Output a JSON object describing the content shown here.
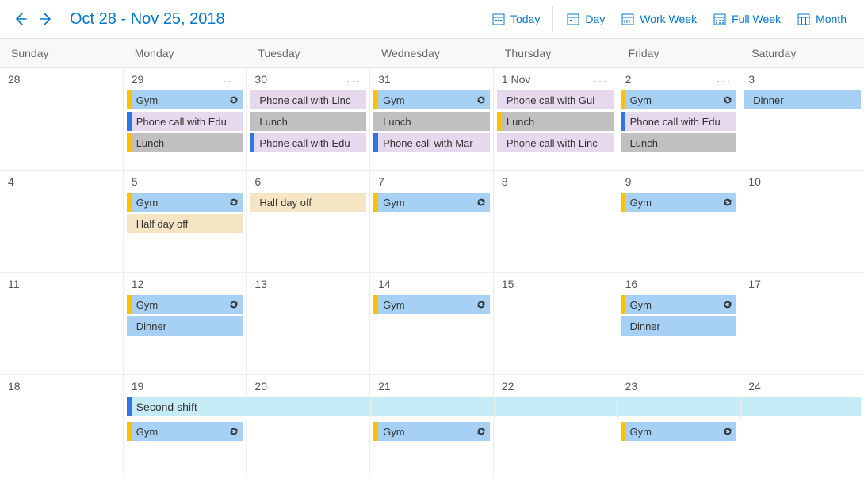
{
  "header": {
    "title": "Oct 28 - Nov 25, 2018",
    "today": "Today",
    "day": "Day",
    "workweek": "Work Week",
    "fullweek": "Full Week",
    "month": "Month"
  },
  "days": [
    "Sunday",
    "Monday",
    "Tuesday",
    "Wednesday",
    "Thursday",
    "Friday",
    "Saturday"
  ],
  "weeks": [
    {
      "cells": [
        {
          "date": "28",
          "overflow": false,
          "events": []
        },
        {
          "date": "29",
          "overflow": true,
          "events": [
            {
              "label": "Gym",
              "bg": "bg-blue",
              "bar": "bar-yellow",
              "recur": true
            },
            {
              "label": "Phone call with Edu",
              "bg": "bg-purple",
              "bar": "bar-blue",
              "recur": false
            },
            {
              "label": "Lunch",
              "bg": "bg-gray",
              "bar": "bar-yellow",
              "recur": false
            }
          ]
        },
        {
          "date": "30",
          "overflow": true,
          "events": [
            {
              "label": "Phone call with Linc",
              "bg": "bg-purple",
              "bar": "bar-none",
              "recur": false
            },
            {
              "label": "Lunch",
              "bg": "bg-gray",
              "bar": "bar-none",
              "recur": false
            },
            {
              "label": "Phone call with Edu",
              "bg": "bg-purple",
              "bar": "bar-blue",
              "recur": false
            }
          ]
        },
        {
          "date": "31",
          "overflow": false,
          "events": [
            {
              "label": "Gym",
              "bg": "bg-blue",
              "bar": "bar-yellow",
              "recur": true
            },
            {
              "label": "Lunch",
              "bg": "bg-gray",
              "bar": "bar-none",
              "recur": false
            },
            {
              "label": "Phone call with Mar",
              "bg": "bg-purple",
              "bar": "bar-blue",
              "recur": false
            }
          ]
        },
        {
          "date": "1 Nov",
          "overflow": true,
          "events": [
            {
              "label": "Phone call with Gui",
              "bg": "bg-purple",
              "bar": "bar-none",
              "recur": false
            },
            {
              "label": "Lunch",
              "bg": "bg-gray",
              "bar": "bar-yellow",
              "recur": false
            },
            {
              "label": "Phone call with Linc",
              "bg": "bg-purple",
              "bar": "bar-none",
              "recur": false
            }
          ]
        },
        {
          "date": "2",
          "overflow": true,
          "events": [
            {
              "label": "Gym",
              "bg": "bg-blue",
              "bar": "bar-yellow",
              "recur": true
            },
            {
              "label": "Phone call with Edu",
              "bg": "bg-purple",
              "bar": "bar-blue",
              "recur": false
            },
            {
              "label": "Lunch",
              "bg": "bg-gray",
              "bar": "bar-none",
              "recur": false
            }
          ]
        },
        {
          "date": "3",
          "overflow": false,
          "events": [
            {
              "label": "Dinner",
              "bg": "bg-blue",
              "bar": "bar-none",
              "recur": false
            }
          ]
        }
      ]
    },
    {
      "cells": [
        {
          "date": "4",
          "overflow": false,
          "events": []
        },
        {
          "date": "5",
          "overflow": false,
          "events": [
            {
              "label": "Gym",
              "bg": "bg-blue",
              "bar": "bar-yellow",
              "recur": true
            },
            {
              "label": "Half day off",
              "bg": "bg-beige",
              "bar": "bar-none",
              "recur": false
            }
          ]
        },
        {
          "date": "6",
          "overflow": false,
          "events": [
            {
              "label": "Half day off",
              "bg": "bg-beige",
              "bar": "bar-none",
              "recur": false
            }
          ]
        },
        {
          "date": "7",
          "overflow": false,
          "events": [
            {
              "label": "Gym",
              "bg": "bg-blue",
              "bar": "bar-yellow",
              "recur": true
            }
          ]
        },
        {
          "date": "8",
          "overflow": false,
          "events": []
        },
        {
          "date": "9",
          "overflow": false,
          "events": [
            {
              "label": "Gym",
              "bg": "bg-blue",
              "bar": "bar-yellow",
              "recur": true
            }
          ]
        },
        {
          "date": "10",
          "overflow": false,
          "events": []
        }
      ]
    },
    {
      "cells": [
        {
          "date": "11",
          "overflow": false,
          "events": []
        },
        {
          "date": "12",
          "overflow": false,
          "events": [
            {
              "label": "Gym",
              "bg": "bg-blue",
              "bar": "bar-yellow",
              "recur": true
            },
            {
              "label": "Dinner",
              "bg": "bg-blue",
              "bar": "bar-none",
              "recur": false
            }
          ]
        },
        {
          "date": "13",
          "overflow": false,
          "events": []
        },
        {
          "date": "14",
          "overflow": false,
          "events": [
            {
              "label": "Gym",
              "bg": "bg-blue",
              "bar": "bar-yellow",
              "recur": true
            }
          ]
        },
        {
          "date": "15",
          "overflow": false,
          "events": []
        },
        {
          "date": "16",
          "overflow": false,
          "events": [
            {
              "label": "Gym",
              "bg": "bg-blue",
              "bar": "bar-yellow",
              "recur": true
            },
            {
              "label": "Dinner",
              "bg": "bg-blue",
              "bar": "bar-none",
              "recur": false
            }
          ]
        },
        {
          "date": "17",
          "overflow": false,
          "events": []
        }
      ]
    },
    {
      "cells": [
        {
          "date": "18"
        },
        {
          "date": "19"
        },
        {
          "date": "20"
        },
        {
          "date": "21"
        },
        {
          "date": "22"
        },
        {
          "date": "23"
        },
        {
          "date": "24"
        }
      ],
      "span_event": {
        "label": "Second shift",
        "bg": "bg-cyan",
        "bar": "bar-blue"
      },
      "below": [
        {
          "col": 1,
          "label": "Gym",
          "bg": "bg-blue",
          "bar": "bar-yellow",
          "recur": true
        },
        {
          "col": 3,
          "label": "Gym",
          "bg": "bg-blue",
          "bar": "bar-yellow",
          "recur": true
        },
        {
          "col": 5,
          "label": "Gym",
          "bg": "bg-blue",
          "bar": "bar-yellow",
          "recur": true
        }
      ]
    }
  ]
}
